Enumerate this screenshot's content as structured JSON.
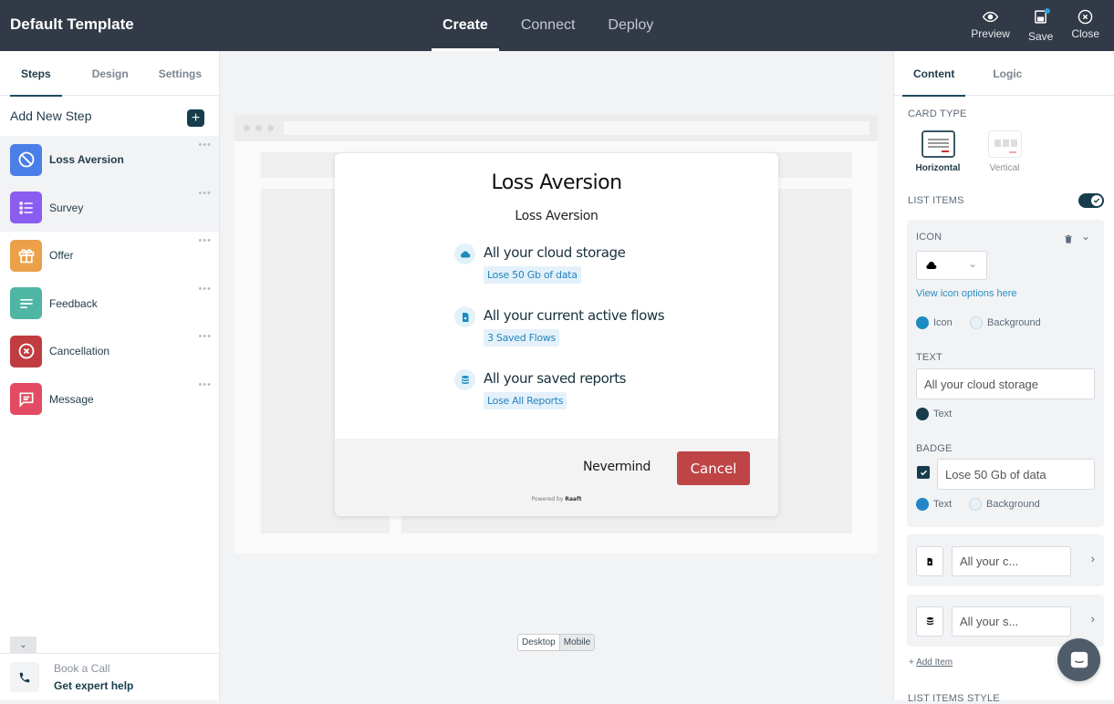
{
  "app": {
    "title": "Default Template"
  },
  "main_tabs": [
    {
      "label": "Create",
      "active": true
    },
    {
      "label": "Connect",
      "active": false
    },
    {
      "label": "Deploy",
      "active": false
    }
  ],
  "top_actions": {
    "preview": "Preview",
    "save": "Save",
    "close": "Close"
  },
  "left": {
    "tabs": [
      {
        "label": "Steps",
        "active": true
      },
      {
        "label": "Design",
        "active": false
      },
      {
        "label": "Settings",
        "active": false
      }
    ],
    "add_step_label": "Add New Step",
    "steps": [
      {
        "label": "Loss Aversion",
        "icon": "ban-icon",
        "color": "#4a7fe8"
      },
      {
        "label": "Survey",
        "icon": "list-icon",
        "color": "#8b5cf0"
      },
      {
        "label": "Offer",
        "icon": "gift-icon",
        "color": "#eca04a"
      },
      {
        "label": "Feedback",
        "icon": "text-lines-icon",
        "color": "#4fb6a3"
      },
      {
        "label": "Cancellation",
        "icon": "x-circle-icon",
        "color": "#c13c40"
      },
      {
        "label": "Message",
        "icon": "chat-icon",
        "color": "#e24b63"
      }
    ],
    "more_label": "•••",
    "book_call": {
      "line1": "Book a Call",
      "line2": "Get expert help"
    }
  },
  "modal": {
    "title": "Loss Aversion",
    "subtitle": "Loss Aversion",
    "items": [
      {
        "icon": "cloud-icon",
        "text": "All your cloud storage",
        "badge": "Lose 50 Gb of data"
      },
      {
        "icon": "file-icon",
        "text": "All your current active flows",
        "badge": "3 Saved Flows"
      },
      {
        "icon": "database-icon",
        "text": "All your saved reports",
        "badge": "Lose All Reports"
      }
    ],
    "nevermind": "Nevermind",
    "cancel": "Cancel",
    "powered_prefix": "Powered by",
    "powered_brand": "Raaft"
  },
  "device_toggle": {
    "desktop": "Desktop",
    "mobile": "Mobile",
    "selected": "Desktop"
  },
  "right": {
    "tabs": [
      {
        "label": "Content",
        "active": true
      },
      {
        "label": "Logic",
        "active": false
      }
    ],
    "card_type_label": "CARD TYPE",
    "card_types": [
      {
        "label": "Horizontal",
        "selected": true
      },
      {
        "label": "Vertical",
        "selected": false
      }
    ],
    "list_items_label": "LIST ITEMS",
    "list_items_enabled": true,
    "icon_label": "ICON",
    "view_icon_link": "View icon options here",
    "icon_radio": {
      "icon": "Icon",
      "background": "Background"
    },
    "icon_color": "#1a8cc0",
    "icon_bg_color": "#e6f1f8",
    "text_label": "TEXT",
    "text_value": "All your cloud storage",
    "text_color_label": "Text",
    "text_color": "#173d4c",
    "badge_label": "BADGE",
    "badge_enabled": true,
    "badge_value": "Lose 50 Gb of data",
    "badge_radio": {
      "text": "Text",
      "background": "Background"
    },
    "badge_text_color": "#2386c7",
    "collapsed_items": [
      {
        "icon": "file-icon",
        "value": "All your c..."
      },
      {
        "icon": "database-icon",
        "value": "All your s..."
      }
    ],
    "add_item": "Add Item",
    "list_items_style": "LIST ITEMS STYLE"
  }
}
